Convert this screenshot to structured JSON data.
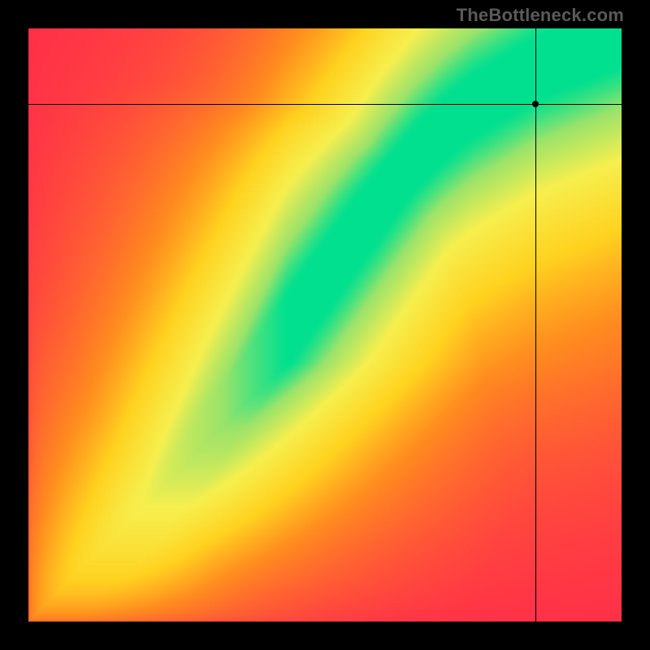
{
  "watermark": "TheBottleneck.com",
  "chart_data": {
    "type": "heatmap",
    "title": "",
    "xlabel": "",
    "ylabel": "",
    "xlim": [
      0,
      1
    ],
    "ylim": [
      0,
      1
    ],
    "grid": false,
    "legend": false,
    "color_stops": [
      {
        "t": 0.0,
        "color": "#ff2b4a"
      },
      {
        "t": 0.35,
        "color": "#ff8a1f"
      },
      {
        "t": 0.55,
        "color": "#ffd21f"
      },
      {
        "t": 0.75,
        "color": "#f6ef4e"
      },
      {
        "t": 0.9,
        "color": "#9be36a"
      },
      {
        "t": 1.0,
        "color": "#00e08f"
      }
    ],
    "ridge": [
      {
        "x": 0.0,
        "y": 0.0
      },
      {
        "x": 0.05,
        "y": 0.03
      },
      {
        "x": 0.1,
        "y": 0.07
      },
      {
        "x": 0.15,
        "y": 0.12
      },
      {
        "x": 0.2,
        "y": 0.17
      },
      {
        "x": 0.25,
        "y": 0.23
      },
      {
        "x": 0.3,
        "y": 0.3
      },
      {
        "x": 0.35,
        "y": 0.37
      },
      {
        "x": 0.4,
        "y": 0.44
      },
      {
        "x": 0.45,
        "y": 0.51
      },
      {
        "x": 0.5,
        "y": 0.58
      },
      {
        "x": 0.55,
        "y": 0.65
      },
      {
        "x": 0.6,
        "y": 0.72
      },
      {
        "x": 0.65,
        "y": 0.78
      },
      {
        "x": 0.7,
        "y": 0.83
      },
      {
        "x": 0.75,
        "y": 0.87
      },
      {
        "x": 0.8,
        "y": 0.9
      },
      {
        "x": 0.85,
        "y": 0.93
      },
      {
        "x": 0.9,
        "y": 0.95
      },
      {
        "x": 0.95,
        "y": 0.97
      },
      {
        "x": 1.0,
        "y": 0.99
      }
    ],
    "ridge_width": 0.05,
    "falloff": 2.4,
    "crosshair": {
      "x": 0.855,
      "y": 0.872
    },
    "marker": {
      "x": 0.855,
      "y": 0.872
    }
  }
}
